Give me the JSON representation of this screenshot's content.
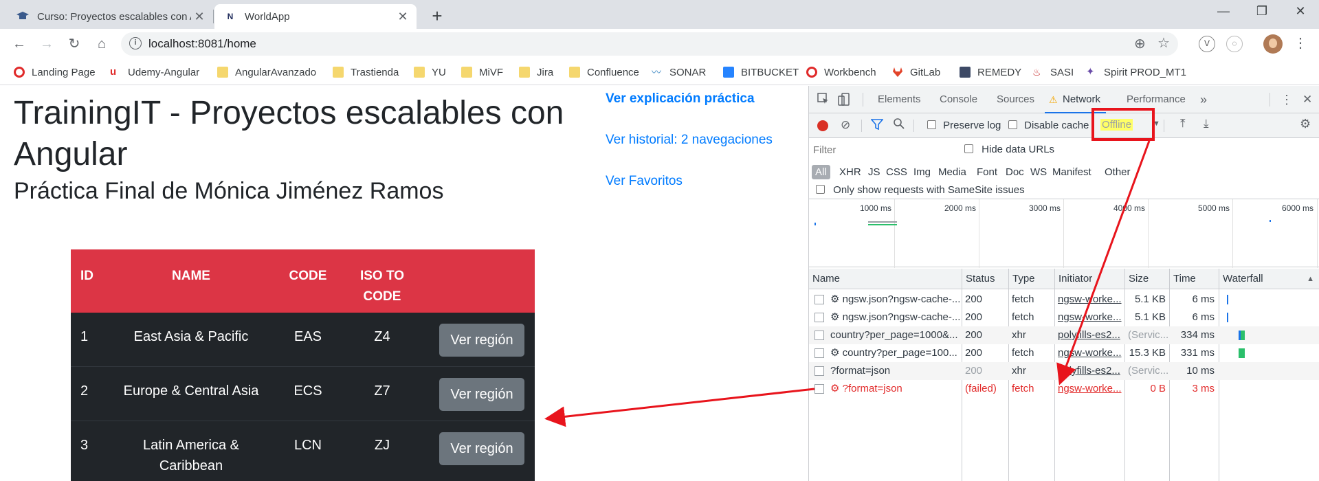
{
  "browser": {
    "tabs": [
      {
        "title": "Curso: Proyectos escalables con A",
        "favicon": "graduation-cap-icon",
        "active": false
      },
      {
        "title": "WorldApp",
        "favicon": "N",
        "active": true
      }
    ],
    "url": "localhost:8081/home",
    "bookmarks": [
      {
        "label": "Landing Page",
        "icon": "opera-icon"
      },
      {
        "label": "Udemy-Angular",
        "icon": "udemy-icon"
      },
      {
        "label": "AngularAvanzado",
        "icon": "folder-icon"
      },
      {
        "label": "Trastienda",
        "icon": "folder-icon"
      },
      {
        "label": "YU",
        "icon": "folder-icon"
      },
      {
        "label": "MiVF",
        "icon": "folder-icon"
      },
      {
        "label": "Jira",
        "icon": "folder-icon"
      },
      {
        "label": "Confluence",
        "icon": "folder-icon"
      },
      {
        "label": "SONAR",
        "icon": "sonar-icon"
      },
      {
        "label": "BITBUCKET",
        "icon": "bitbucket-icon"
      },
      {
        "label": "Workbench",
        "icon": "opera-icon"
      },
      {
        "label": "GitLab",
        "icon": "gitlab-icon"
      },
      {
        "label": "REMEDY",
        "icon": "remedy-icon"
      },
      {
        "label": "SASI",
        "icon": "java-icon"
      },
      {
        "label": "Spirit PROD_MT1",
        "icon": "spirit-icon"
      }
    ]
  },
  "page": {
    "title": "TrainingIT - Proyectos escalables con Angular",
    "subtitle": "Práctica Final de Mónica Jiménez Ramos",
    "links": {
      "practica": "Ver explicación práctica",
      "historial": "Ver historial: 2 navegaciones",
      "favoritos": "Ver Favoritos"
    },
    "table": {
      "headers": {
        "id": "ID",
        "name": "NAME",
        "code": "CODE",
        "iso": "ISO TO CODE"
      },
      "rows": [
        {
          "id": "1",
          "name": "East Asia & Pacific",
          "code": "EAS",
          "iso": "Z4",
          "button": "Ver región"
        },
        {
          "id": "2",
          "name": "Europe & Central Asia",
          "code": "ECS",
          "iso": "Z7",
          "button": "Ver región"
        },
        {
          "id": "3",
          "name": "Latin America & Caribbean",
          "code": "LCN",
          "iso": "ZJ",
          "button": "Ver región"
        }
      ]
    }
  },
  "devtools": {
    "tabs": [
      "Elements",
      "Console",
      "Sources",
      "Network",
      "Performance"
    ],
    "more": "»",
    "preserve_log": "Preserve log",
    "disable_cache": "Disable cache",
    "throttle": "Offline",
    "filter_placeholder": "Filter",
    "hide_data_urls": "Hide data URLs",
    "types": [
      "All",
      "XHR",
      "JS",
      "CSS",
      "Img",
      "Media",
      "Font",
      "Doc",
      "WS",
      "Manifest",
      "Other"
    ],
    "samesite": "Only show requests with SameSite issues",
    "timeline_ticks": [
      "1000 ms",
      "2000 ms",
      "3000 ms",
      "4000 ms",
      "5000 ms",
      "6000 ms"
    ],
    "columns": {
      "name": "Name",
      "status": "Status",
      "type": "Type",
      "initiator": "Initiator",
      "size": "Size",
      "time": "Time",
      "waterfall": "Waterfall"
    },
    "requests": [
      {
        "name": "ngsw.json?ngsw-cache-...",
        "gear": true,
        "status": "200",
        "type": "fetch",
        "initiator": "ngsw-worke...",
        "size": "5.1 KB",
        "time": "6 ms",
        "state": "ok"
      },
      {
        "name": "ngsw.json?ngsw-cache-...",
        "gear": true,
        "status": "200",
        "type": "fetch",
        "initiator": "ngsw-worke...",
        "size": "5.1 KB",
        "time": "6 ms",
        "state": "ok"
      },
      {
        "name": "country?per_page=1000&...",
        "gear": false,
        "status": "200",
        "type": "xhr",
        "initiator": "polyfills-es2...",
        "size": "(Servic...",
        "time": "334 ms",
        "state": "ok"
      },
      {
        "name": "country?per_page=100...",
        "gear": true,
        "status": "200",
        "type": "fetch",
        "initiator": "ngsw-worke...",
        "size": "15.3 KB",
        "time": "331 ms",
        "state": "ok"
      },
      {
        "name": "?format=json",
        "gear": false,
        "status": "200",
        "type": "xhr",
        "initiator": "polyfills-es2...",
        "size": "(Servic...",
        "time": "10 ms",
        "state": "pending"
      },
      {
        "name": "?format=json",
        "gear": true,
        "status": "(failed)",
        "type": "fetch",
        "initiator": "ngsw-worke...",
        "size": "0 B",
        "time": "3 ms",
        "state": "failed"
      }
    ]
  },
  "colors": {
    "table_header": "#dc3545",
    "table_body": "#212529",
    "button": "#6c757d",
    "link": "#007bff",
    "annotation": "#e8141c",
    "failed": "#e22c2c"
  }
}
